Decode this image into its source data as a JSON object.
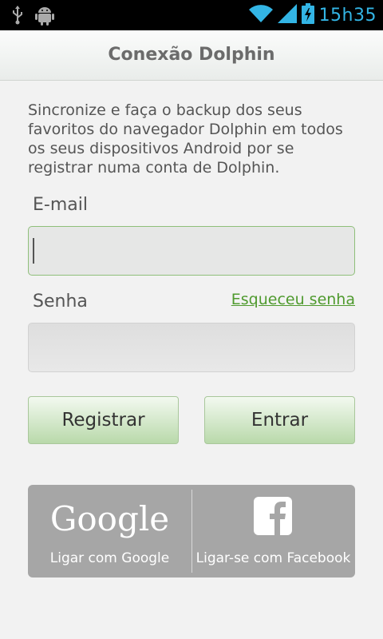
{
  "status_bar": {
    "time": "15h35",
    "left_icons": [
      "usb-icon",
      "android-debug-icon"
    ],
    "right_icons": [
      "wifi-icon",
      "signal-icon",
      "battery-charging-icon"
    ]
  },
  "header": {
    "title": "Conexão Dolphin"
  },
  "intro": {
    "text": "Sincronize e faça o backup dos seus favoritos do navegador Dolphin em todos os seus dispositivos Android por se registrar numa conta de Dolphin."
  },
  "form": {
    "email": {
      "label": "E-mail",
      "value": "",
      "placeholder": ""
    },
    "password": {
      "label": "Senha",
      "value": "",
      "placeholder": ""
    },
    "forgot_link": "Esqueceu senha"
  },
  "buttons": {
    "register": "Registrar",
    "login": "Entrar"
  },
  "social": {
    "google": {
      "logo_text": "Google",
      "label": "Ligar com Google"
    },
    "facebook": {
      "logo_icon": "facebook-icon",
      "label": "Ligar-se com Facebook"
    }
  },
  "colors": {
    "accent": "#33b5e5",
    "link": "#4f9a2e",
    "button_gradient_bottom": "#b9d9aa",
    "social_bg": "#a6a6a6"
  }
}
